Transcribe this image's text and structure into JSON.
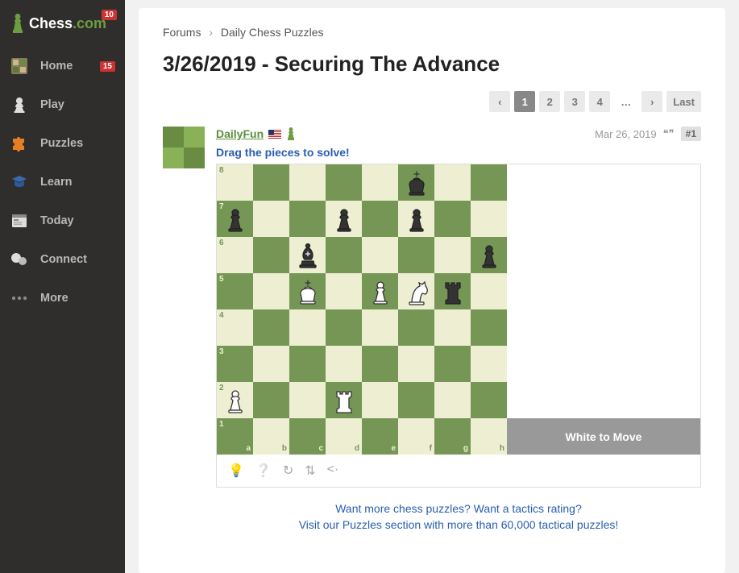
{
  "logo": {
    "text1": "Chess",
    "text2": ".com",
    "badge": "10"
  },
  "nav": [
    {
      "label": "Home",
      "icon": "home",
      "badge": "15"
    },
    {
      "label": "Play",
      "icon": "play"
    },
    {
      "label": "Puzzles",
      "icon": "puzzle"
    },
    {
      "label": "Learn",
      "icon": "learn"
    },
    {
      "label": "Today",
      "icon": "today"
    },
    {
      "label": "Connect",
      "icon": "connect"
    },
    {
      "label": "More",
      "icon": "more"
    }
  ],
  "breadcrumb": {
    "a": "Forums",
    "b": "Daily Chess Puzzles"
  },
  "title": "3/26/2019 - Securing The Advance",
  "pagination": {
    "prev": "‹",
    "pages": [
      "1",
      "2",
      "3",
      "4"
    ],
    "dots": "…",
    "next": "›",
    "last": "Last",
    "active": "1"
  },
  "post": {
    "author": "DailyFun",
    "date": "Mar 26, 2019",
    "num": "#1",
    "drag": "Drag the pieces to solve!"
  },
  "board": {
    "status": "White to Move",
    "ranks": [
      "8",
      "7",
      "6",
      "5",
      "4",
      "3",
      "2",
      "1"
    ],
    "files": [
      "a",
      "b",
      "c",
      "d",
      "e",
      "f",
      "g",
      "h"
    ],
    "pieces": [
      {
        "sq": "f8",
        "type": "k",
        "color": "b"
      },
      {
        "sq": "a7",
        "type": "p",
        "color": "b"
      },
      {
        "sq": "d7",
        "type": "p",
        "color": "b"
      },
      {
        "sq": "f7",
        "type": "p",
        "color": "b"
      },
      {
        "sq": "c6",
        "type": "b",
        "color": "b"
      },
      {
        "sq": "h6",
        "type": "p",
        "color": "b"
      },
      {
        "sq": "c5",
        "type": "k",
        "color": "w"
      },
      {
        "sq": "e5",
        "type": "p",
        "color": "w"
      },
      {
        "sq": "f5",
        "type": "n",
        "color": "w"
      },
      {
        "sq": "g5",
        "type": "r",
        "color": "b"
      },
      {
        "sq": "a2",
        "type": "p",
        "color": "w"
      },
      {
        "sq": "d2",
        "type": "r",
        "color": "w"
      }
    ]
  },
  "toolbar": [
    "💡",
    "?",
    "↻",
    "⇅",
    "‹›"
  ],
  "footer": {
    "l1": "Want more chess puzzles? Want a tactics rating?",
    "l2": "Visit our Puzzles section with more than 60,000 tactical puzzles!"
  }
}
